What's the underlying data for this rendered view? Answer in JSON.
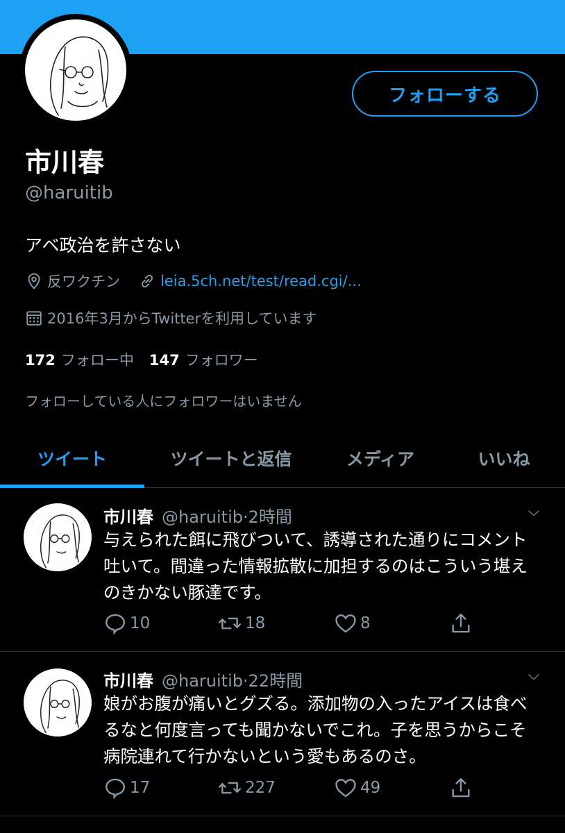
{
  "colors": {
    "accent": "#1DA1F2",
    "background": "#000000",
    "muted": "#8899A6",
    "divider": "#2F3336"
  },
  "profile": {
    "follow_label": "フォローする",
    "display_name": "市川春",
    "handle": "@haruitib",
    "bio": "アベ政治を許さない",
    "location": "反ワクチン",
    "website": "leia.5ch.net/test/read.cgi/...",
    "joined": "2016年3月からTwitterを利用しています",
    "following_count": "172",
    "following_label": "フォロー中",
    "followers_count": "147",
    "followers_label": "フォロワー",
    "followers_you_know": "フォローしている人にフォロワーはいません"
  },
  "tabs": [
    {
      "label": "ツイート",
      "active": true
    },
    {
      "label": "ツイートと返信",
      "active": false
    },
    {
      "label": "メディア",
      "active": false
    },
    {
      "label": "いいね",
      "active": false
    }
  ],
  "tweets": [
    {
      "name": "市川春",
      "handle": "@haruitib",
      "separator": "·",
      "time": "2時間",
      "text": "与えられた餌に飛びついて、誘導された通りにコメント吐いて。間違った情報拡散に加担するのはこういう堪えのきかない豚達です。",
      "replies": "10",
      "retweets": "18",
      "likes": "8"
    },
    {
      "name": "市川春",
      "handle": "@haruitib",
      "separator": "·",
      "time": "22時間",
      "text": "娘がお腹が痛いとグズる。添加物の入ったアイスは食べるなと何度言っても聞かないでこれ。子を思うからこそ病院連れて行かないという愛もあるのさ。",
      "replies": "17",
      "retweets": "227",
      "likes": "49"
    }
  ],
  "icons": [
    "location-icon",
    "link-icon",
    "calendar-icon",
    "reply-icon",
    "retweet-icon",
    "like-icon",
    "share-icon",
    "chevron-down-icon"
  ]
}
